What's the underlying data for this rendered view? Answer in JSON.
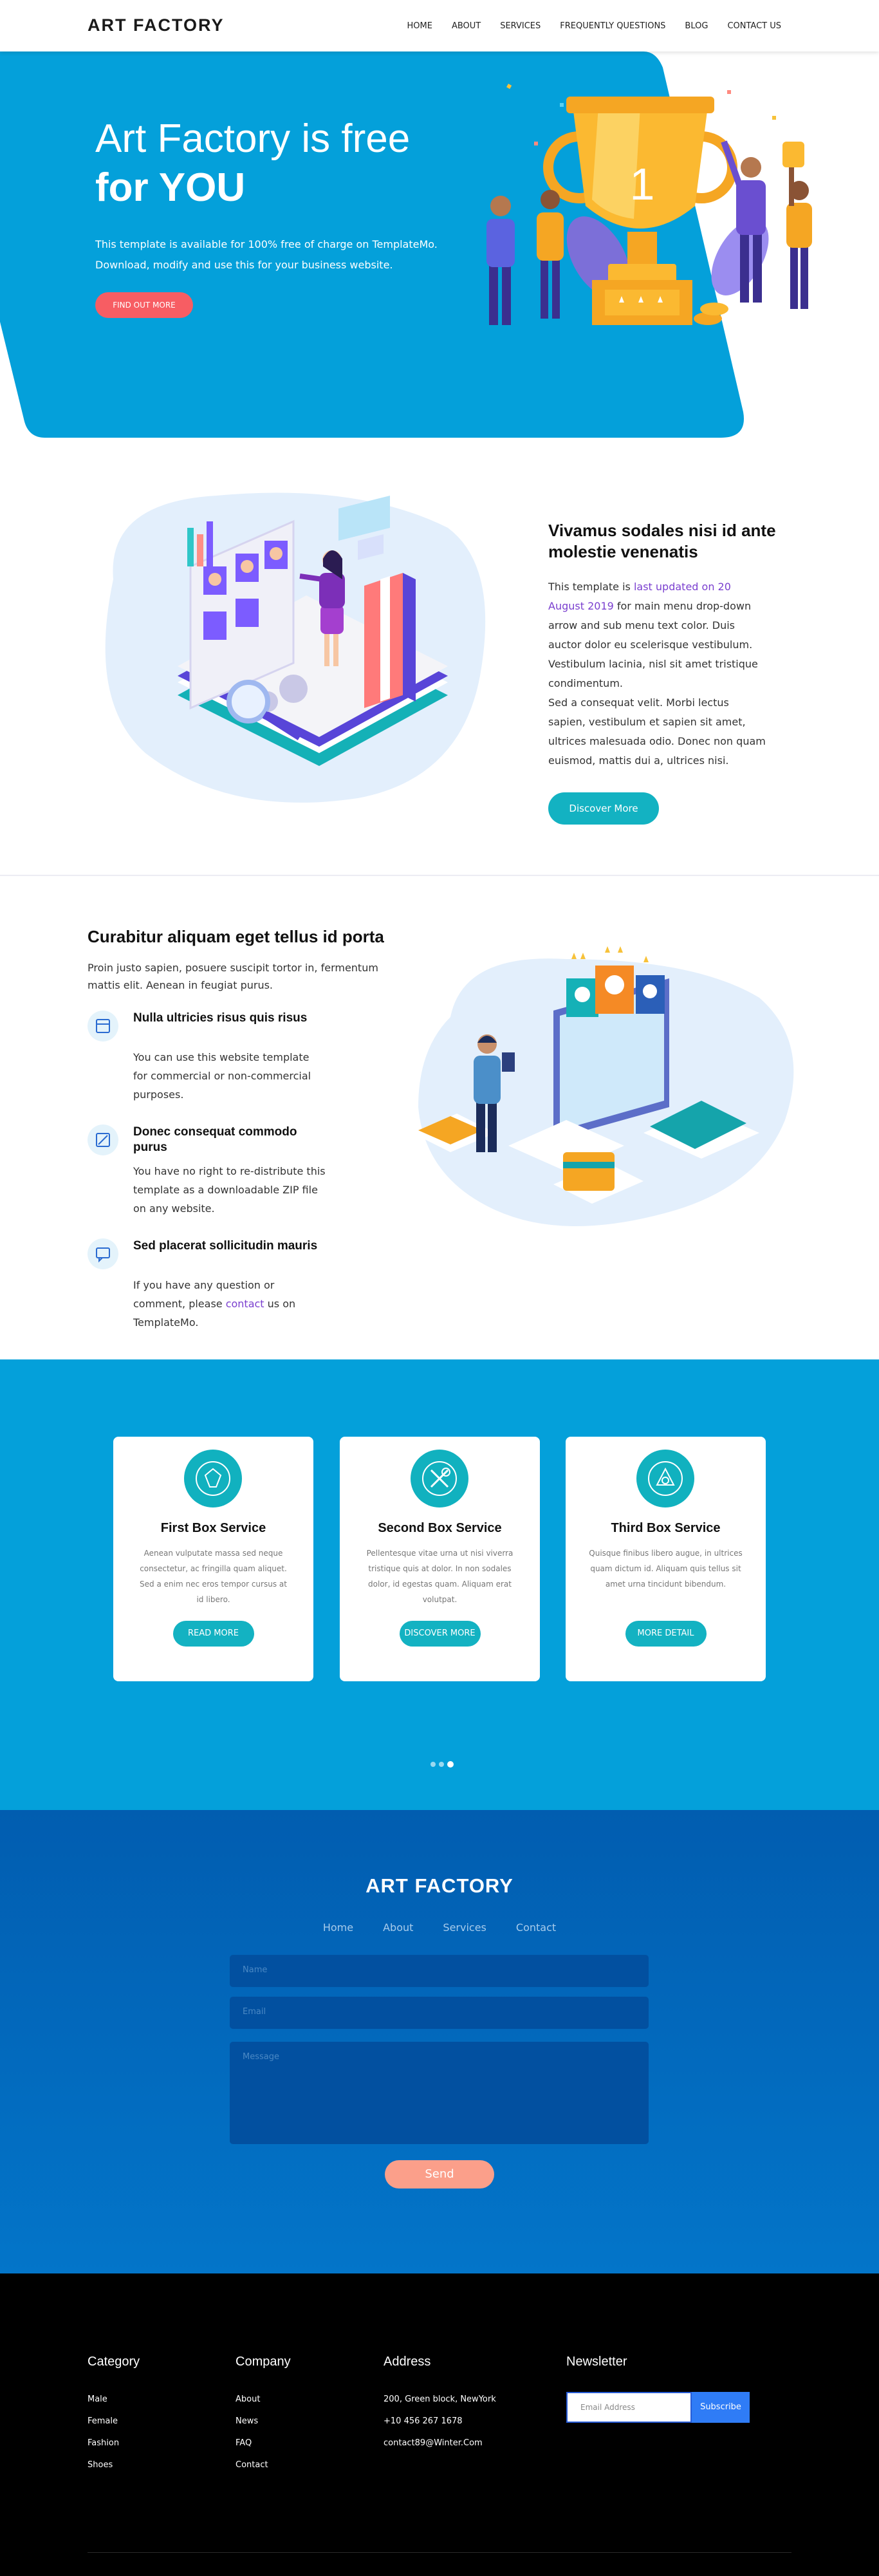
{
  "header": {
    "logo": "ART FACTORY",
    "menu": [
      "HOME",
      "ABOUT",
      "SERVICES",
      "FREQUENTLY QUESTIONS",
      "BLOG",
      "CONTACT US"
    ]
  },
  "hero": {
    "title_line1": "Art Factory is free",
    "title_line2": "for YOU",
    "text": "This template is available for 100% free of charge on TemplateMo. Download, modify and use this for your business website.",
    "button": "FIND OUT MORE",
    "trophy_number": "1"
  },
  "about": {
    "title": "Vivamus sodales nisi id ante molestie venenatis",
    "p1_before": "This template is ",
    "p1_link": "last updated on 20 August 2019",
    "p1_after": " for main menu drop-down arrow and sub menu text color. Duis auctor dolor eu scelerisque vestibulum. Vestibulum lacinia, nisl sit amet tristique condimentum.",
    "p2": "Sed a consequat velit. Morbi lectus sapien, vestibulum et sapien sit amet, ultrices malesuada odio. Donec non quam euismod, mattis dui a, ultrices nisi.",
    "button": "Discover More"
  },
  "features": {
    "title": "Curabitur aliquam eget tellus id porta",
    "intro": "Proin justo sapien, posuere suscipit tortor in, fermentum mattis elit. Aenean in feugiat purus.",
    "items": [
      {
        "title": "Nulla ultricies risus quis risus",
        "desc": "You can use this website template for commercial or non-commercial purposes."
      },
      {
        "title": "Donec consequat commodo purus",
        "desc": "You have no right to re-distribute this template as a downloadable ZIP file on any website."
      },
      {
        "title": "Sed placerat sollicitudin mauris",
        "desc_before": "If you have any question or comment, please ",
        "desc_link": "contact",
        "desc_after": " us on TemplateMo."
      }
    ]
  },
  "services": {
    "cards": [
      {
        "title": "First Box Service",
        "text": "Aenean vulputate massa sed neque consectetur, ac fringilla quam aliquet. Sed a enim nec eros tempor cursus at id libero.",
        "button": "READ MORE"
      },
      {
        "title": "Second Box Service",
        "text": "Pellentesque vitae urna ut nisi viverra tristique quis at dolor. In non sodales dolor, id egestas quam. Aliquam erat volutpat.",
        "button": "DISCOVER MORE"
      },
      {
        "title": "Third Box Service",
        "text": "Quisque finibus libero augue, in ultrices quam dictum id. Aliquam quis tellus sit amet urna tincidunt bibendum.",
        "button": "MORE DETAIL"
      }
    ]
  },
  "contact": {
    "title": "ART FACTORY",
    "links": [
      "Home",
      "About",
      "Services",
      "Contact"
    ],
    "name_placeholder": "Name",
    "email_placeholder": "Email",
    "message_placeholder": "Message",
    "button": "Send"
  },
  "footer": {
    "category": {
      "title": "Category",
      "items": [
        "Male",
        "Female",
        "Fashion",
        "Shoes"
      ]
    },
    "company": {
      "title": "Company",
      "items": [
        "About",
        "News",
        "FAQ",
        "Contact"
      ]
    },
    "address": {
      "title": "Address",
      "items": [
        "200, Green block, NewYork",
        "+10 456 267 1678",
        "contact89@Winter.Com"
      ]
    },
    "newsletter": {
      "title": "Newsletter",
      "placeholder": "Email Address",
      "button": "Subscribe"
    }
  },
  "colors": {
    "primary_blue": "#04a0da",
    "accent_red": "#f75d63",
    "teal": "#13b2c2",
    "dark_blue": "#015db0"
  }
}
